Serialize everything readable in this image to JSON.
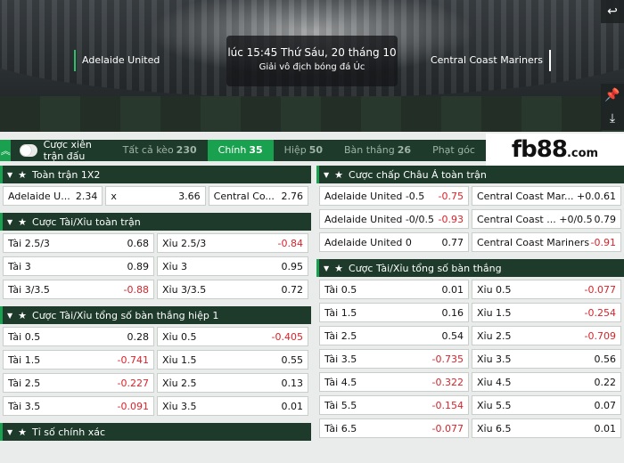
{
  "banner": {
    "home_team": "Adelaide United",
    "away_team": "Central Coast Mariners",
    "time": "lúc 15:45 Thứ Sáu, 20 tháng 10",
    "league": "Giải vô địch bóng đá Úc",
    "side_buttons": [
      "undo-icon",
      "pin-icon",
      "download-icon"
    ]
  },
  "tabbar": {
    "toggle_label": "Cược xiên trận đấu",
    "tabs": [
      {
        "label": "Tất cả kèo",
        "count": "230"
      },
      {
        "label": "Chính",
        "count": "35"
      },
      {
        "label": "Hiệp",
        "count": "50"
      },
      {
        "label": "Bàn thắng",
        "count": "26"
      },
      {
        "label": "Phạt góc",
        "count": ""
      }
    ]
  },
  "logo": {
    "main": "fb88",
    "suffix": ".com"
  },
  "left_panels": [
    {
      "title": "Toàn trận 1X2",
      "rows": [
        [
          {
            "l": "Adelaide U...",
            "o": "2.34"
          },
          {
            "l": "x",
            "o": "3.66"
          },
          {
            "l": "Central Co...",
            "o": "2.76"
          }
        ]
      ]
    },
    {
      "title": "Cược Tài/Xỉu toàn trận",
      "rows": [
        [
          {
            "l": "Tài 2.5/3",
            "o": "0.68"
          },
          {
            "l": "Xỉu 2.5/3",
            "o": "-0.84"
          }
        ],
        [
          {
            "l": "Tài 3",
            "o": "0.89"
          },
          {
            "l": "Xỉu 3",
            "o": "0.95"
          }
        ],
        [
          {
            "l": "Tài 3/3.5",
            "o": "-0.88"
          },
          {
            "l": "Xỉu 3/3.5",
            "o": "0.72"
          }
        ]
      ]
    },
    {
      "title": "Cược Tài/Xỉu tổng số bàn thắng hiệp 1",
      "rows": [
        [
          {
            "l": "Tài 0.5",
            "o": "0.28"
          },
          {
            "l": "Xỉu 0.5",
            "o": "-0.405"
          }
        ],
        [
          {
            "l": "Tài 1.5",
            "o": "-0.741"
          },
          {
            "l": "Xỉu 1.5",
            "o": "0.55"
          }
        ],
        [
          {
            "l": "Tài 2.5",
            "o": "-0.227"
          },
          {
            "l": "Xỉu 2.5",
            "o": "0.13"
          }
        ],
        [
          {
            "l": "Tài 3.5",
            "o": "-0.091"
          },
          {
            "l": "Xỉu 3.5",
            "o": "0.01"
          }
        ]
      ]
    },
    {
      "title": "Tỉ số chính xác",
      "rows": []
    }
  ],
  "right_panels": [
    {
      "title": "Cược chấp Châu Á toàn trận",
      "rows": [
        [
          {
            "l": "Adelaide United -0.5",
            "o": "-0.75"
          },
          {
            "l": "Central Coast Mar...  +0.5",
            "o": "0.61"
          }
        ],
        [
          {
            "l": "Adelaide United -0/0.5",
            "o": "-0.93"
          },
          {
            "l": "Central Coast ...  +0/0.5",
            "o": "0.79"
          }
        ],
        [
          {
            "l": "Adelaide United 0",
            "o": "0.77"
          },
          {
            "l": "Central Coast Mariners 0",
            "o": "-0.91"
          }
        ]
      ]
    },
    {
      "title": "Cược Tài/Xỉu tổng số bàn thắng",
      "rows": [
        [
          {
            "l": "Tài 0.5",
            "o": "0.01"
          },
          {
            "l": "Xỉu 0.5",
            "o": "-0.077"
          }
        ],
        [
          {
            "l": "Tài 1.5",
            "o": "0.16"
          },
          {
            "l": "Xỉu 1.5",
            "o": "-0.254"
          }
        ],
        [
          {
            "l": "Tài 2.5",
            "o": "0.54"
          },
          {
            "l": "Xỉu 2.5",
            "o": "-0.709"
          }
        ],
        [
          {
            "l": "Tài 3.5",
            "o": "-0.735"
          },
          {
            "l": "Xỉu 3.5",
            "o": "0.56"
          }
        ],
        [
          {
            "l": "Tài 4.5",
            "o": "-0.322"
          },
          {
            "l": "Xỉu 4.5",
            "o": "0.22"
          }
        ],
        [
          {
            "l": "Tài 5.5",
            "o": "-0.154"
          },
          {
            "l": "Xỉu 5.5",
            "o": "0.07"
          }
        ],
        [
          {
            "l": "Tài 6.5",
            "o": "-0.077"
          },
          {
            "l": "Xỉu 6.5",
            "o": "0.01"
          }
        ]
      ]
    }
  ],
  "colors": {
    "header_bg": "#1d3a2a",
    "accent": "#1aa14f",
    "negative": "#d8232a"
  }
}
